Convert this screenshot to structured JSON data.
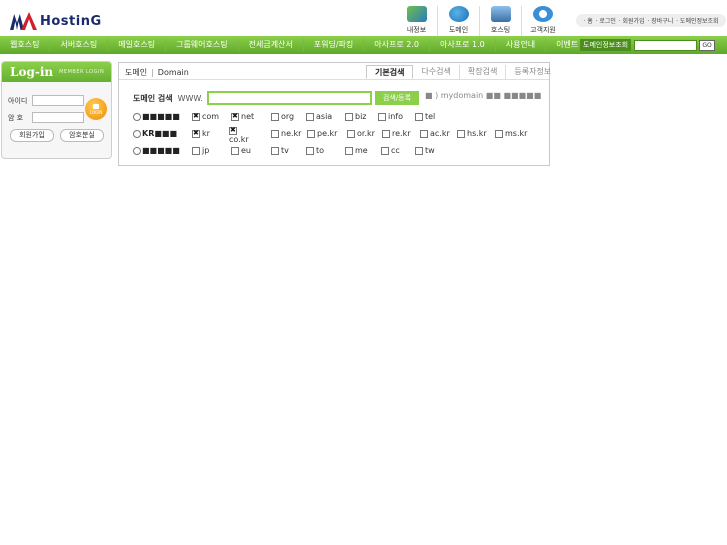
{
  "logo": {
    "text": "HostinG"
  },
  "top_icons": [
    {
      "icon": "my-info-icon",
      "label": "내정보"
    },
    {
      "icon": "domain-icon",
      "label": "도메인"
    },
    {
      "icon": "hosting-icon",
      "label": "호스팅"
    },
    {
      "icon": "support-icon",
      "label": "고객지원"
    }
  ],
  "util_links": [
    "· 홈",
    "· 로그인",
    "· 회원가입",
    "· 장바구니",
    "· 도메인정보조회"
  ],
  "nav": {
    "items": [
      "웹호스팅",
      "서버호스팅",
      "메일호스팅",
      "그룹웨어호스팅",
      "전세금계산서",
      "포워딩/파킹",
      "아사프로 2.0",
      "아사프로 1.0",
      "사용안내",
      "이벤트"
    ],
    "lookup_label": "도메인정보조회",
    "lookup_value": "",
    "go_label": "GO"
  },
  "login": {
    "title": "Log-in",
    "subtitle": "MEMBER LOGIN",
    "id_label": "아이디",
    "pw_label": "암  호",
    "login_button": "LOGIN",
    "signup_label": "회원가입",
    "find_pw_label": "암호분실"
  },
  "domain": {
    "title": "도메인",
    "title_en": "Domain",
    "tabs": [
      {
        "label": "기본검색",
        "active": true
      },
      {
        "label": "다수검색",
        "active": false
      },
      {
        "label": "확장검색",
        "active": false
      },
      {
        "label": "등록자정보",
        "active": false
      }
    ],
    "search_label": "도메인 검색",
    "www": "WWW.",
    "search_value": "",
    "search_button": "검색/등록",
    "mydomain": "■ ) mydomain ■■ ■■■■■",
    "groups": [
      {
        "label": "■■■■■",
        "tlds": [
          {
            "name": "com",
            "checked": true
          },
          {
            "name": "net",
            "checked": true
          },
          {
            "name": "org",
            "checked": false
          },
          {
            "name": "asia",
            "checked": false
          },
          {
            "name": "biz",
            "checked": false
          },
          {
            "name": "info",
            "checked": false
          },
          {
            "name": "tel",
            "checked": false
          }
        ]
      },
      {
        "label": "KR■■■",
        "tlds": [
          {
            "name": "kr",
            "checked": true
          },
          {
            "name": "co.kr",
            "checked": true
          },
          {
            "name": "ne.kr",
            "checked": false
          },
          {
            "name": "pe.kr",
            "checked": false
          },
          {
            "name": "or.kr",
            "checked": false
          },
          {
            "name": "re.kr",
            "checked": false
          },
          {
            "name": "ac.kr",
            "checked": false
          },
          {
            "name": "hs.kr",
            "checked": false
          },
          {
            "name": "ms.kr",
            "checked": false
          }
        ]
      },
      {
        "label": "■■■■■",
        "tlds": [
          {
            "name": "jp",
            "checked": false
          },
          {
            "name": "eu",
            "checked": false
          },
          {
            "name": "tv",
            "checked": false
          },
          {
            "name": "to",
            "checked": false
          },
          {
            "name": "me",
            "checked": false
          },
          {
            "name": "cc",
            "checked": false
          },
          {
            "name": "tw",
            "checked": false
          }
        ]
      }
    ]
  },
  "colors": {
    "accent": "#8ccf4a",
    "brand_navy": "#1b2a6b",
    "brand_red": "#d0202a"
  }
}
